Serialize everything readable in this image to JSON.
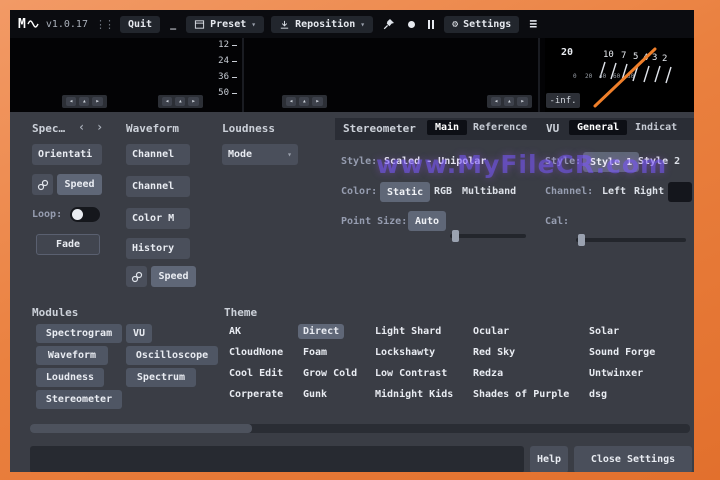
{
  "titlebar": {
    "logo": "M",
    "version": "v1.0.17",
    "quit": "Quit",
    "preset": "Preset",
    "reposition": "Reposition",
    "settings": "Settings"
  },
  "icons": {
    "drag": "⋮⋮",
    "minimize": "_",
    "caret_down": "▾",
    "gear": "⚙",
    "menu": "≡",
    "nav_left": "◂",
    "nav_up": "▴",
    "nav_right": "▸",
    "prev": "‹",
    "next": "›"
  },
  "meters": {
    "db_ticks": [
      "12",
      "24",
      "36",
      "50"
    ],
    "vu_top": [
      "20",
      "10",
      "7",
      "5",
      "4",
      "3",
      "2"
    ],
    "vu_bottom": [
      "0",
      "20",
      "40",
      "60",
      "80"
    ],
    "inf": "-inf."
  },
  "spec": {
    "title": "Spec…",
    "orientation": "Orientati",
    "speed": "Speed",
    "loop_label": "Loop:",
    "fade": "Fade"
  },
  "waveform": {
    "title": "Waveform",
    "channel1": "Channel",
    "channel2": "Channel",
    "color_mode": "Color M",
    "history": "History",
    "speed": "Speed"
  },
  "loudness": {
    "title": "Loudness",
    "mode": "Mode"
  },
  "stereometer": {
    "title": "Stereometer",
    "tab_main": "Main",
    "tab_reference": "Reference",
    "style_label": "Style:",
    "style_value": "Scaled - Unipolar",
    "color_label": "Color:",
    "color_static": "Static",
    "color_rgb": "RGB",
    "color_multiband": "Multiband",
    "point_label": "Point Size:",
    "point_value": "Auto"
  },
  "vu": {
    "title": "VU",
    "tab_general": "General",
    "tab_indicator": "Indicat",
    "style_label": "Style:",
    "style1": "Style 1",
    "style2": "Style 2",
    "channel_label": "Channel:",
    "left": "Left",
    "right": "Right",
    "cal_label": "Cal:"
  },
  "modules": {
    "title": "Modules",
    "items": [
      "Spectrogram",
      "VU",
      "Waveform",
      "Oscilloscope",
      "Loudness",
      "Spectrum",
      "Stereometer"
    ]
  },
  "theme": {
    "title": "Theme",
    "columns": [
      [
        "AK",
        "CloudNone",
        "Cool Edit",
        "Corperate"
      ],
      [
        "Direct",
        "Foam",
        "Grow Cold",
        "Gunk"
      ],
      [
        "Light Shard",
        "Lockshawty",
        "Low Contrast",
        "Midnight Kids"
      ],
      [
        "Ocular",
        "Red Sky",
        "Redza",
        "Shades of Purple"
      ],
      [
        "Solar",
        "Sound Forge",
        "Untwinxer",
        "dsg"
      ]
    ]
  },
  "footer": {
    "help": "Help",
    "close": "Close Settings"
  },
  "watermark": "www.MyFileCR.com"
}
